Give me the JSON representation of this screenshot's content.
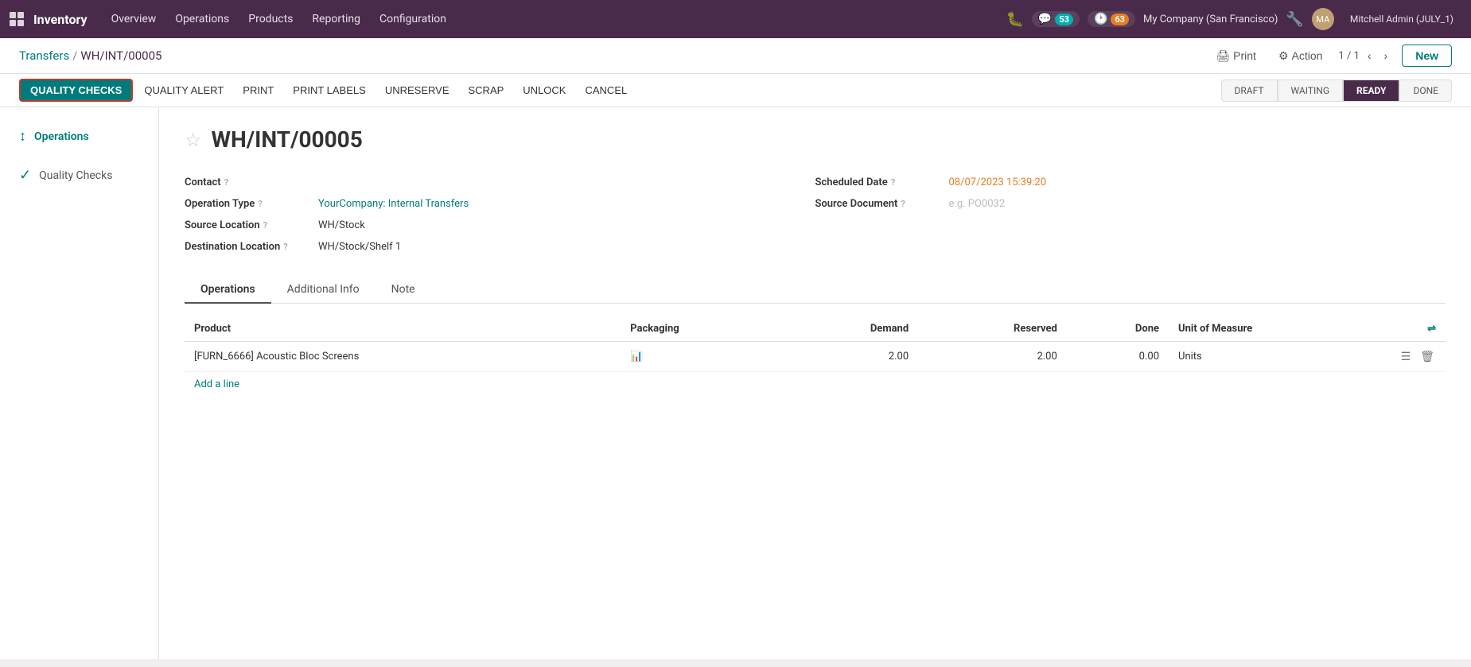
{
  "topnav": {
    "app": "Inventory",
    "items": [
      "Overview",
      "Operations",
      "Products",
      "Reporting",
      "Configuration"
    ],
    "chat_badge": "53",
    "activity_badge": "63",
    "company": "My Company (San Francisco)",
    "user": "Mitchell Admin (JULY_1)"
  },
  "header": {
    "breadcrumb_parent": "Transfers",
    "breadcrumb_current": "WH/INT/00005",
    "print_label": "Print",
    "action_label": "Action",
    "pagination": "1 / 1",
    "new_label": "New"
  },
  "actionbar": {
    "quality_checks": "QUALITY CHECKS",
    "quality_alert": "QUALITY ALERT",
    "print": "PRINT",
    "print_labels": "PRINT LABELS",
    "unreserve": "UNRESERVE",
    "scrap": "SCRAP",
    "unlock": "UNLOCK",
    "cancel": "CANCEL",
    "status_steps": [
      "DRAFT",
      "WAITING",
      "READY",
      "DONE"
    ]
  },
  "side_panel": {
    "tabs": [
      {
        "label": "Operations",
        "icon": "↕"
      },
      {
        "label": "Quality Checks",
        "icon": "✓"
      }
    ]
  },
  "form": {
    "record_id": "WH/INT/00005",
    "contact_label": "Contact",
    "contact_value": "",
    "scheduled_date_label": "Scheduled Date",
    "scheduled_date_value": "08/07/2023 15:39:20",
    "operation_type_label": "Operation Type",
    "operation_type_value": "YourCompany: Internal Transfers",
    "source_document_label": "Source Document",
    "source_document_placeholder": "e.g. PO0032",
    "source_location_label": "Source Location",
    "source_location_value": "WH/Stock",
    "destination_location_label": "Destination Location",
    "destination_location_value": "WH/Stock/Shelf 1"
  },
  "tabs": {
    "items": [
      "Operations",
      "Additional Info",
      "Note"
    ],
    "active": "Operations"
  },
  "table": {
    "columns": [
      "Product",
      "Packaging",
      "Demand",
      "Reserved",
      "Done",
      "Unit of Measure"
    ],
    "rows": [
      {
        "product": "[FURN_6666] Acoustic Bloc Screens",
        "packaging": "",
        "demand": "2.00",
        "reserved": "2.00",
        "done": "0.00",
        "unit": "Units"
      }
    ],
    "add_line": "Add a line"
  }
}
